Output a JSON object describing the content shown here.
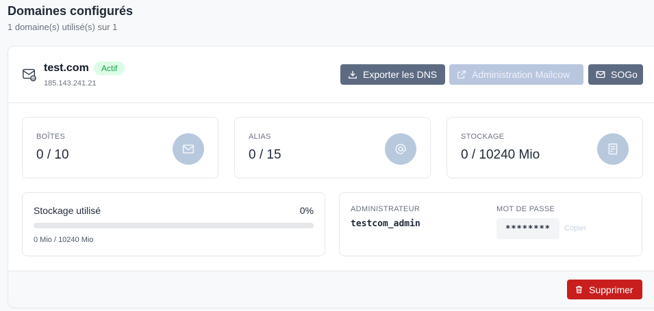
{
  "header": {
    "title": "Domaines configurés",
    "subtitle": "1 domaine(s) utilisé(s) sur 1"
  },
  "domain": {
    "name": "test.com",
    "status": "Actif",
    "ip": "185.143.241.21",
    "icon": "mail-at-icon"
  },
  "actions": {
    "export_dns": "Exporter les DNS",
    "admin_mailcow": "Administration Mailcow",
    "sogo": "SOGo",
    "delete": "Supprimer"
  },
  "stats": [
    {
      "label": "BOÎTES",
      "value": "0 / 10",
      "icon": "envelope-icon"
    },
    {
      "label": "ALIAS",
      "value": "0 / 15",
      "icon": "at-icon"
    },
    {
      "label": "STOCKAGE",
      "value": "0 / 10240 Mio",
      "icon": "storage-icon"
    }
  ],
  "storage_usage": {
    "title": "Stockage utilisé",
    "percent_label": "0%",
    "fill_percent": 0,
    "detail": "0 Mio / 10240 Mio"
  },
  "credentials": {
    "admin_label": "ADMINISTRATEUR",
    "admin_value": "testcom_admin",
    "password_label": "MOT DE PASSE",
    "password_value": "********",
    "copy_label": "Copier"
  },
  "colors": {
    "primary": "#5d6b82",
    "disabled": "#b8c6de",
    "danger": "#c81e1e",
    "success_bg": "#dcfce7",
    "success_text": "#16a34a"
  }
}
